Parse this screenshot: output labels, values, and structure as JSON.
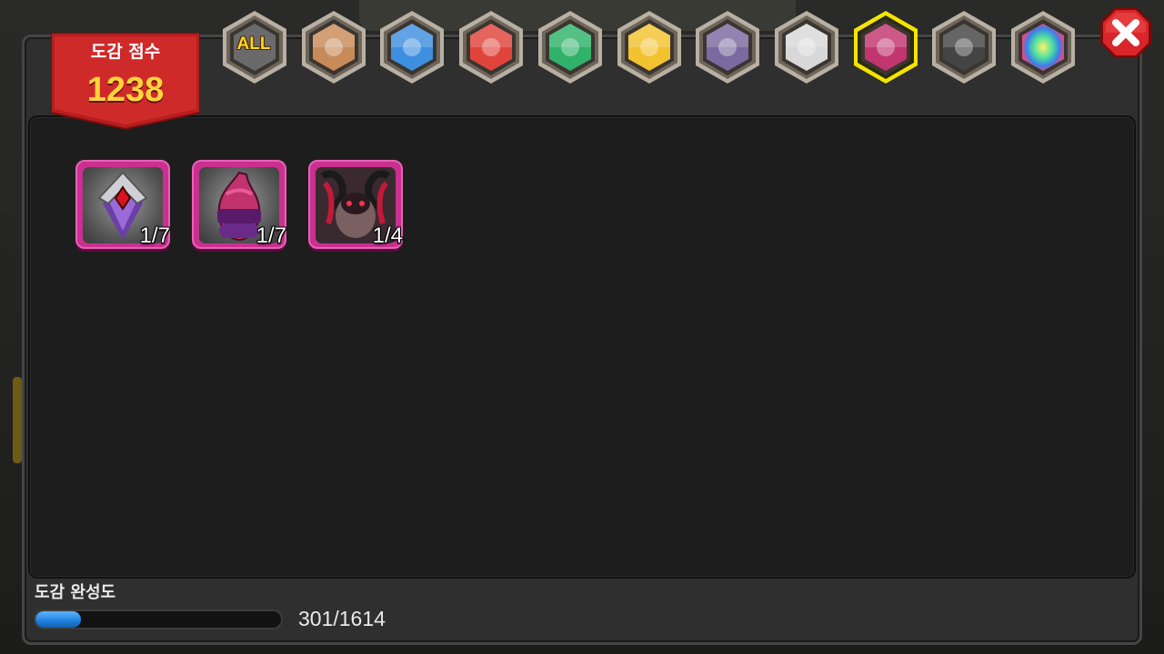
{
  "score": {
    "title": "도감 점수",
    "value": "1238"
  },
  "tabs": [
    {
      "id": "all",
      "label": "ALL",
      "icon": "all-icon",
      "color": "#8a8a8a",
      "selected": false
    },
    {
      "id": "earth",
      "icon": "earth-element-icon",
      "color": "#c98a5a",
      "selected": false
    },
    {
      "id": "water",
      "icon": "water-element-icon",
      "color": "#3f8fe0",
      "selected": false
    },
    {
      "id": "fire",
      "icon": "fire-element-icon",
      "color": "#e0443a",
      "selected": false
    },
    {
      "id": "wind",
      "icon": "wind-element-icon",
      "color": "#2fb36a",
      "selected": false
    },
    {
      "id": "light",
      "icon": "light-element-icon",
      "color": "#f2c230",
      "selected": false
    },
    {
      "id": "dragon",
      "icon": "dragon-element-icon",
      "color": "#7a6aa0",
      "selected": false
    },
    {
      "id": "holy",
      "icon": "holy-element-icon",
      "color": "#d8d8d8",
      "selected": false
    },
    {
      "id": "dark",
      "icon": "dark-element-icon",
      "color": "#c2356e",
      "selected": true
    },
    {
      "id": "shadow",
      "icon": "shadow-element-icon",
      "color": "#444444",
      "selected": false
    },
    {
      "id": "rainbow",
      "icon": "rainbow-element-icon",
      "color": "#6ad0c0",
      "selected": false
    }
  ],
  "items": [
    {
      "icon": "dark-knight-armor-icon",
      "count": "1/7"
    },
    {
      "icon": "dark-egg-icon",
      "count": "1/7"
    },
    {
      "icon": "dark-horned-beast-icon",
      "count": "1/4"
    }
  ],
  "progress": {
    "label": "도감 완성도",
    "text": "301/1614",
    "fraction": 0.186
  },
  "close": {
    "icon": "close-icon"
  }
}
